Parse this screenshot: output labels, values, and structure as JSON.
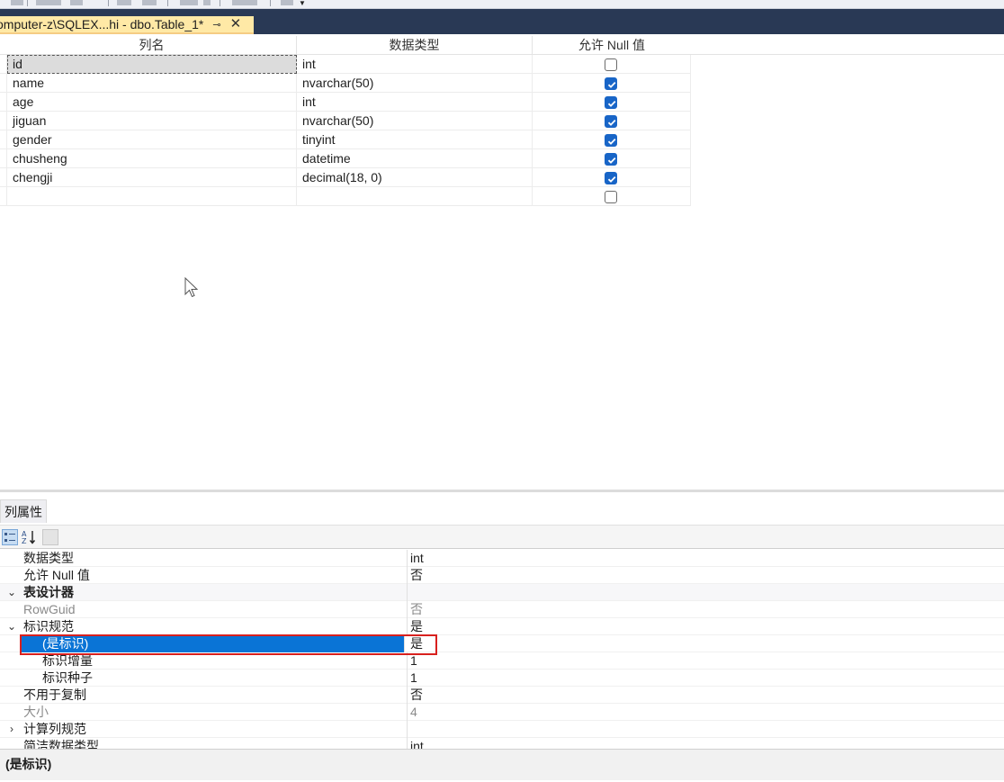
{
  "document_tab": {
    "title": "omputer-z\\SQLEX...hi - dbo.Table_1*",
    "pin_glyph": "⊸",
    "close_glyph": "✕"
  },
  "grid": {
    "headers": {
      "name": "列名",
      "type": "数据类型",
      "null": "允许 Null 值"
    },
    "rows": [
      {
        "name": "id",
        "type": "int",
        "allow_null": false
      },
      {
        "name": "name",
        "type": "nvarchar(50)",
        "allow_null": true
      },
      {
        "name": "age",
        "type": "int",
        "allow_null": true
      },
      {
        "name": "jiguan",
        "type": "nvarchar(50)",
        "allow_null": true
      },
      {
        "name": "gender",
        "type": "tinyint",
        "allow_null": true
      },
      {
        "name": "chusheng",
        "type": "datetime",
        "allow_null": true
      },
      {
        "name": "chengji",
        "type": "decimal(18, 0)",
        "allow_null": true
      },
      {
        "name": "",
        "type": "",
        "allow_null": false
      }
    ]
  },
  "properties_panel": {
    "tab_label": "列属性",
    "rows": [
      {
        "name": "数据类型",
        "value": "int",
        "kind": "plain"
      },
      {
        "name": "允许 Null 值",
        "value": "否",
        "kind": "plain"
      },
      {
        "name": "表设计器",
        "value": "",
        "kind": "category",
        "expander": "⌄"
      },
      {
        "name": "RowGuid",
        "value": "否",
        "kind": "gray"
      },
      {
        "name": "标识规范",
        "value": "是",
        "kind": "plain",
        "expander": "⌄"
      },
      {
        "name": "(是标识)",
        "value": "是",
        "kind": "selected"
      },
      {
        "name": "标识增量",
        "value": "1",
        "kind": "indent"
      },
      {
        "name": "标识种子",
        "value": "1",
        "kind": "indent"
      },
      {
        "name": "不用于复制",
        "value": "否",
        "kind": "plain"
      },
      {
        "name": "大小",
        "value": "4",
        "kind": "gray"
      },
      {
        "name": "计算列规范",
        "value": "",
        "kind": "plain",
        "expander": "›"
      },
      {
        "name": "简洁数据类型",
        "value": "int",
        "kind": "plain"
      }
    ],
    "description": "(是标识)"
  },
  "colors": {
    "tab_well": "#293955",
    "active_tab": "#ffe9a6",
    "checkbox_checked": "#1865c7",
    "selection": "#0a74d6",
    "annotation_box": "#d8201e"
  }
}
